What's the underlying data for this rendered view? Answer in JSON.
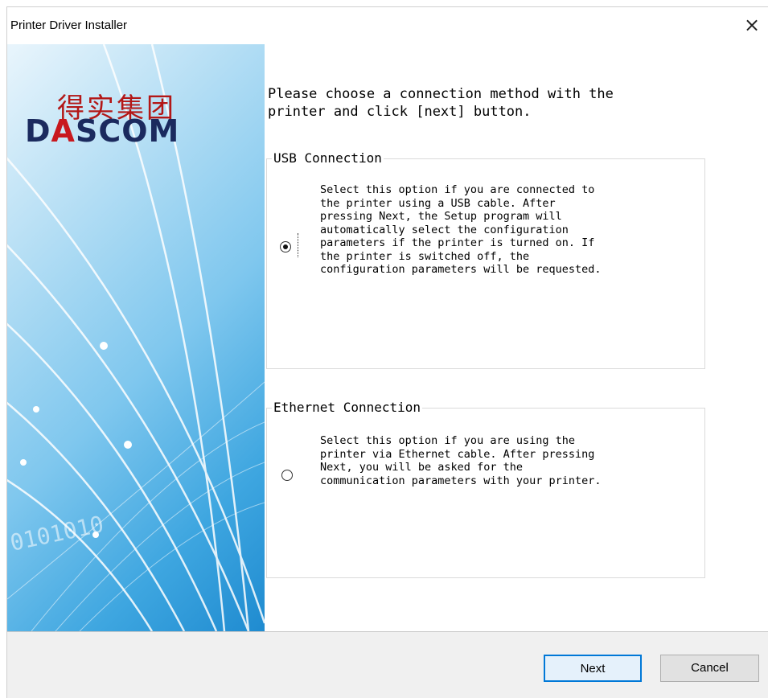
{
  "window": {
    "title": "Printer Driver Installer",
    "close_glyph": "×"
  },
  "banner": {
    "logo_cn": "得实集团",
    "logo_en_1": "D",
    "logo_en_2": "A",
    "logo_en_3": "SCOM",
    "decor_binary": "0101010"
  },
  "heading": "Please choose a connection method with the\nprinter and click [next] button.",
  "options": [
    {
      "legend": "USB Connection",
      "selected": true,
      "description": "Select this option if you are connected to\nthe printer using a USB cable. After\npressing Next, the Setup program will\nautomatically select the configuration\nparameters if the printer is turned on. If\nthe printer is switched off, the\nconfiguration parameters will be requested."
    },
    {
      "legend": "Ethernet Connection",
      "selected": false,
      "description": "Select this option if you are using the\nprinter via Ethernet cable. After pressing\nNext, you will be asked for the\ncommunication parameters with your printer."
    }
  ],
  "buttons": {
    "next": "Next",
    "cancel": "Cancel"
  },
  "colors": {
    "accent": "#0078d7",
    "logo_red": "#c8181e",
    "logo_navy": "#1b2a5e"
  }
}
